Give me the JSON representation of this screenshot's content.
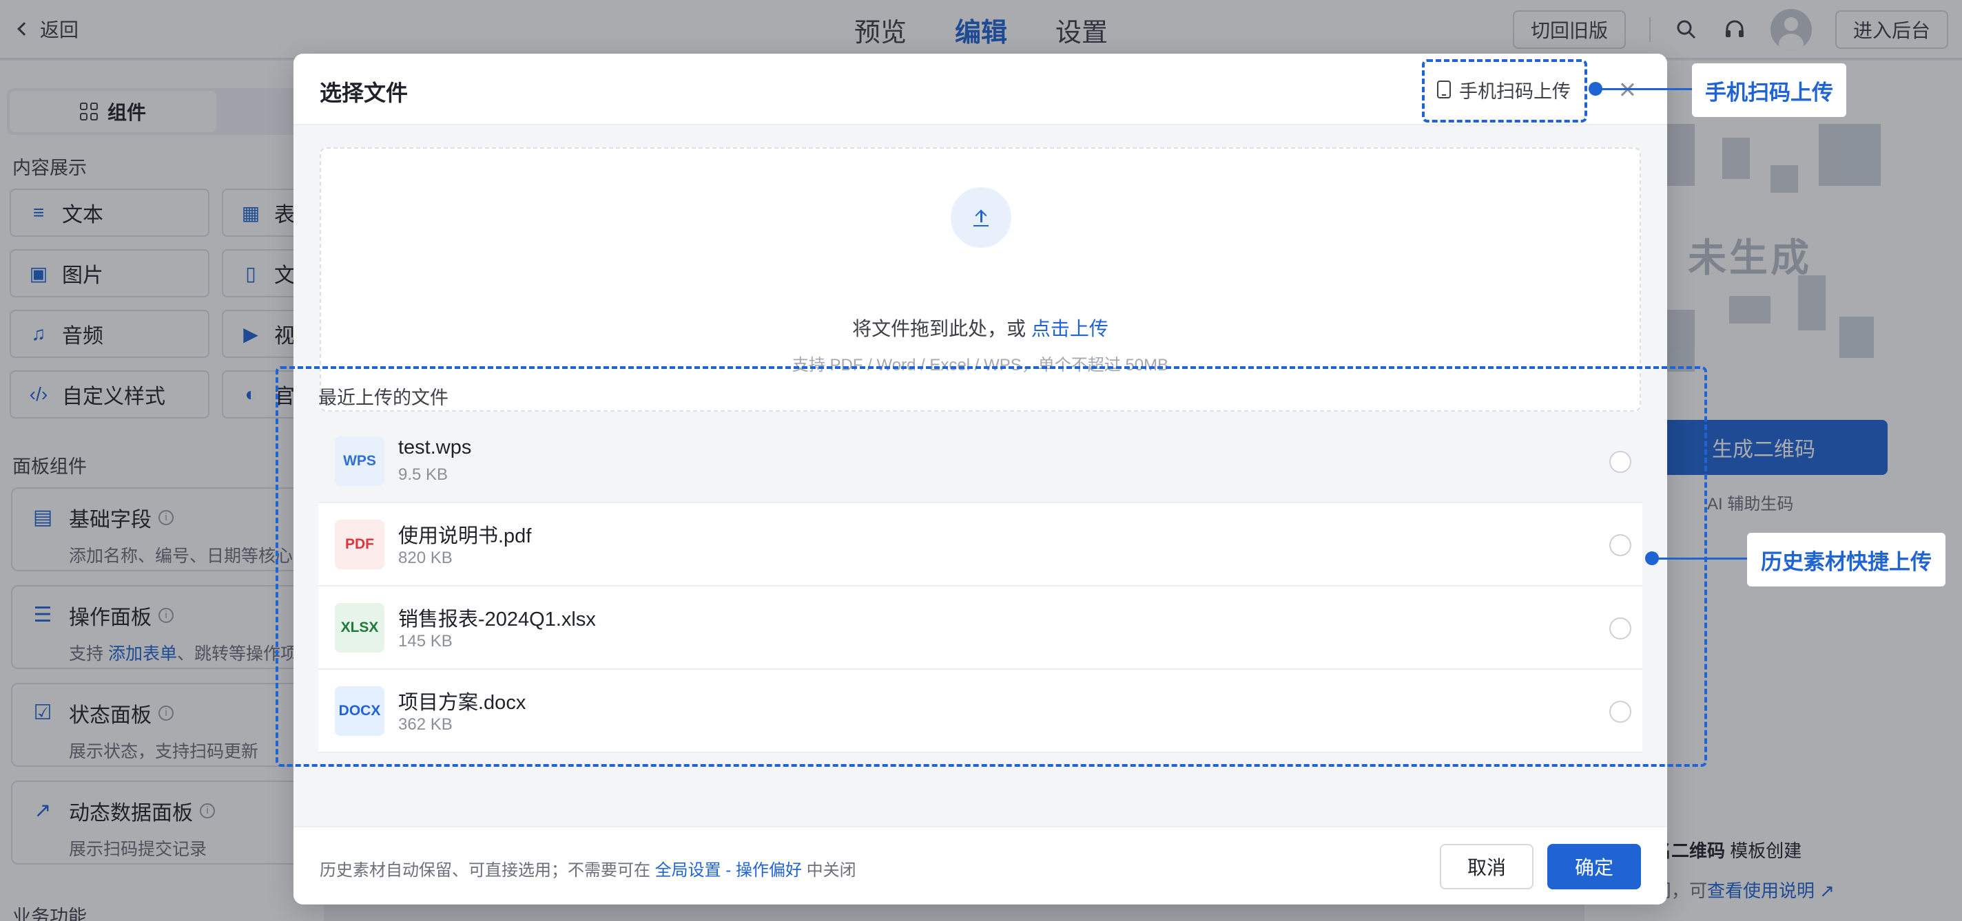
{
  "topbar": {
    "back_label": "返回",
    "nav": [
      "预览",
      "编辑",
      "设置"
    ],
    "nav_active": "编辑",
    "switch_old_label": "切回旧版",
    "admin_label": "进入后台"
  },
  "sidebar": {
    "tab_components": "组件",
    "section_content": "内容展示",
    "content_items": [
      {
        "label": "文本",
        "icon": "text-lines-icon"
      },
      {
        "label": "表",
        "icon": "table-icon"
      },
      {
        "label": "图片",
        "icon": "image-icon"
      },
      {
        "label": "文",
        "icon": "file-icon"
      },
      {
        "label": "音频",
        "icon": "music-icon"
      },
      {
        "label": "视",
        "icon": "video-icon"
      },
      {
        "label": "自定义样式",
        "icon": "code-icon"
      },
      {
        "label": "官",
        "icon": "palette-icon"
      }
    ],
    "section_panels": "面板组件",
    "panels": [
      {
        "title": "基础字段",
        "desc": "添加名称、编号、日期等核心字",
        "icon": "clipboard-icon"
      },
      {
        "title": "操作面板",
        "desc_prefix": "支持 ",
        "desc_link": "添加表单",
        "desc_suffix": "、跳转等操作项",
        "icon": "list-doc-icon"
      },
      {
        "title": "状态面板",
        "desc": "展示状态，支持扫码更新",
        "icon": "checkbox-icon"
      },
      {
        "title": "动态数据面板",
        "desc": "展示扫码提交记录",
        "icon": "trend-icon"
      }
    ],
    "section_business": "业务功能"
  },
  "right_panel": {
    "qr_placeholder": "未生成",
    "generate_label": "生成二维码",
    "ai_hint": "AI 辅助生码",
    "card_bold": "名二维码",
    "card_rest": " 模板创建",
    "card_line2_prefix": "问，可",
    "card_link": "查看使用说明"
  },
  "modal": {
    "title": "选择文件",
    "scan_upload_label": "手机扫码上传",
    "dropzone": {
      "text_prefix": "将文件拖到此处，或 ",
      "text_link": "点击上传",
      "hint": "支持 PDF / Word / Excel / WPS，单个不超过 50MB"
    },
    "recent_title": "最近上传的文件",
    "files": [
      {
        "type": "WPS",
        "name": "test.wps",
        "size": "9.5 KB",
        "color": "#2f6fd6",
        "bg": "#e8f0fb"
      },
      {
        "type": "PDF",
        "name": "使用说明书.pdf",
        "size": "820 KB",
        "color": "#d9363e",
        "bg": "#fdecec"
      },
      {
        "type": "XLSX",
        "name": "销售报表-2024Q1.xlsx",
        "size": "145 KB",
        "color": "#1e7a3c",
        "bg": "#e7f4ea"
      },
      {
        "type": "DOCX",
        "name": "项目方案.docx",
        "size": "362 KB",
        "color": "#1f64d2",
        "bg": "#e4efff"
      }
    ],
    "footer": {
      "text_prefix": "历史素材自动保留、可直接选用；不需要可在 ",
      "text_link": "全局设置 - 操作偏好",
      "text_suffix": " 中关闭",
      "cancel_label": "取消",
      "ok_label": "确定"
    }
  },
  "annotations": {
    "scan_callout": "手机扫码上传",
    "history_callout": "历史素材快捷上传",
    "color": "#1f64d2"
  }
}
